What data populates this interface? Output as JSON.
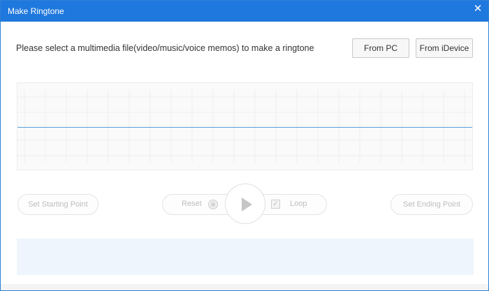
{
  "window": {
    "title": "Make Ringtone",
    "close_glyph": "✕"
  },
  "source": {
    "prompt": "Please select a multimedia file(video/music/voice memos) to make a ringtone",
    "from_pc_label": "From PC",
    "from_idevice_label": "From iDevice"
  },
  "controls": {
    "set_start_label": "Set Starting Point",
    "reset_label": "Reset",
    "loop_label": "Loop",
    "loop_checked_glyph": "✓",
    "set_end_label": "Set Ending Point"
  },
  "colors": {
    "titlebar": "#1f78dd",
    "accent_line": "#58a3dd",
    "disabled_text": "#bdbdbd",
    "progress_band": "#eef5fd"
  }
}
